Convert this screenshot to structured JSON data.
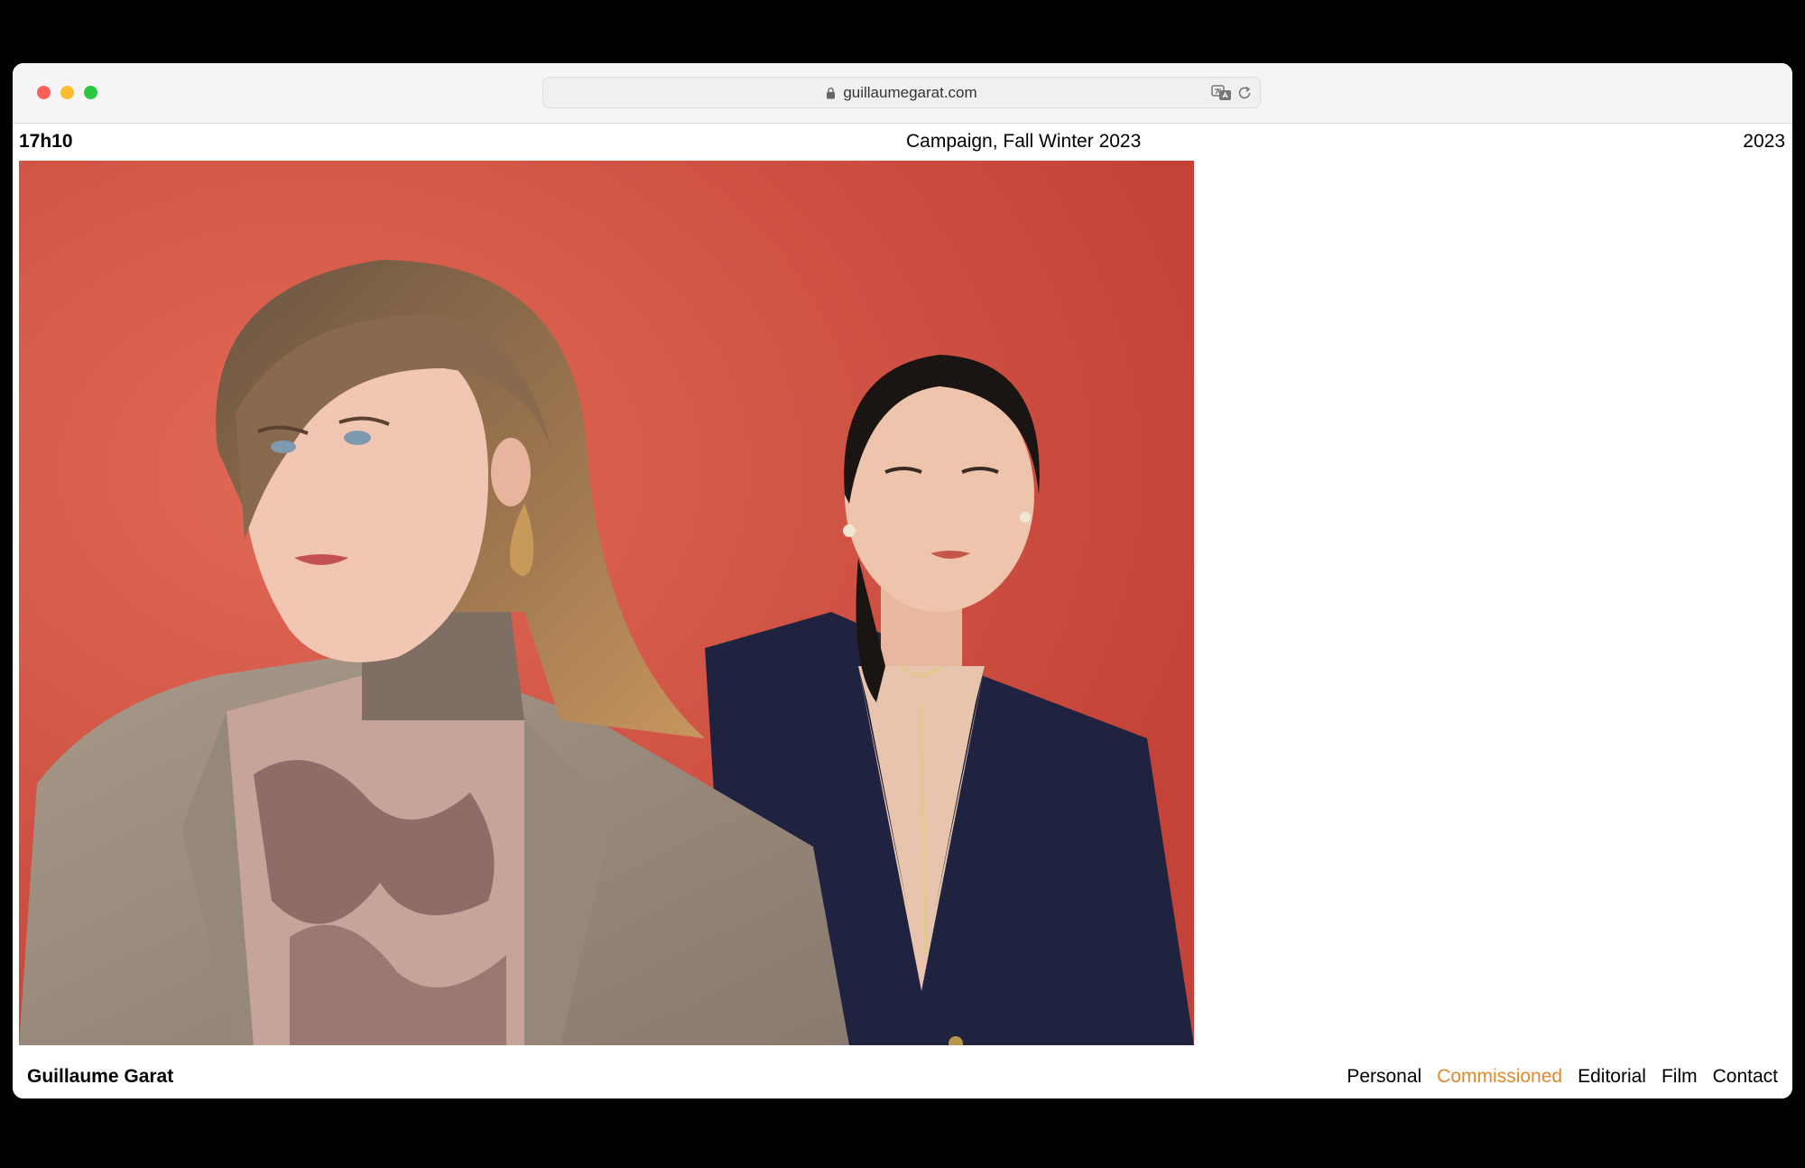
{
  "browser": {
    "url": "guillaumegarat.com"
  },
  "header": {
    "left": "17h10",
    "center": "Campaign, Fall Winter 2023",
    "right": "2023"
  },
  "footer": {
    "name": "Guillaume Garat",
    "nav": [
      {
        "label": "Personal",
        "active": false
      },
      {
        "label": "Commissioned",
        "active": true
      },
      {
        "label": "Editorial",
        "active": false
      },
      {
        "label": "Film",
        "active": false
      },
      {
        "label": "Contact",
        "active": false
      }
    ]
  },
  "colors": {
    "accent": "#e0892d",
    "backdrop": "#d55a48"
  },
  "icons": [
    "lock-icon",
    "translate-icon",
    "reload-icon"
  ]
}
